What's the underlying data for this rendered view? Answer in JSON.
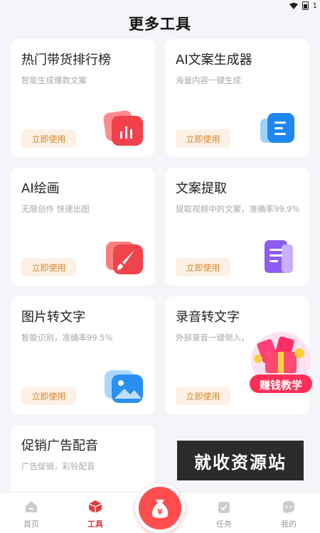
{
  "status": {
    "battery_text": "1"
  },
  "page": {
    "title": "更多工具"
  },
  "cards": [
    {
      "title": "热门带货排行榜",
      "desc": "智能生成爆款文案",
      "button": "立即使用",
      "icon": "bar-chart-icon"
    },
    {
      "title": "AI文案生成器",
      "desc": "海量内容一键生成",
      "button": "立即使用",
      "icon": "document-icon"
    },
    {
      "title": "AI绘画",
      "desc": "无限创作 快速出图",
      "button": "立即使用",
      "icon": "paintbrush-icon"
    },
    {
      "title": "文案提取",
      "desc": "提取视频中的文案，准确率99.9%",
      "button": "立即使用",
      "icon": "pages-icon"
    },
    {
      "title": "图片转文字",
      "desc": "智能识别，准确率99.5%",
      "button": "立即使用",
      "icon": "image-icon"
    },
    {
      "title": "录音转文字",
      "desc": "外部录音一键倒入，",
      "button": "立即使用",
      "icon": "microphone-icon"
    },
    {
      "title": "促销广告配音",
      "desc": "广告促销，彩铃配音",
      "button": "",
      "icon": ""
    }
  ],
  "promo": {
    "label": "赚钱教学"
  },
  "watermark": {
    "text": "就收资源站"
  },
  "tabbar": {
    "items": [
      {
        "label": "首页",
        "icon": "home-icon",
        "active": false
      },
      {
        "label": "工具",
        "icon": "toolbox-icon",
        "active": true
      },
      {
        "label": "任务",
        "icon": "task-icon",
        "active": false
      },
      {
        "label": "我的",
        "icon": "profile-icon",
        "active": false
      }
    ],
    "center_icon": "money-bag-icon",
    "center_text": "¥"
  },
  "colors": {
    "accent": "#e53a3a",
    "button_bg": "#fdf1e5",
    "button_text": "#d3862f",
    "background": "#f4f5f8"
  }
}
